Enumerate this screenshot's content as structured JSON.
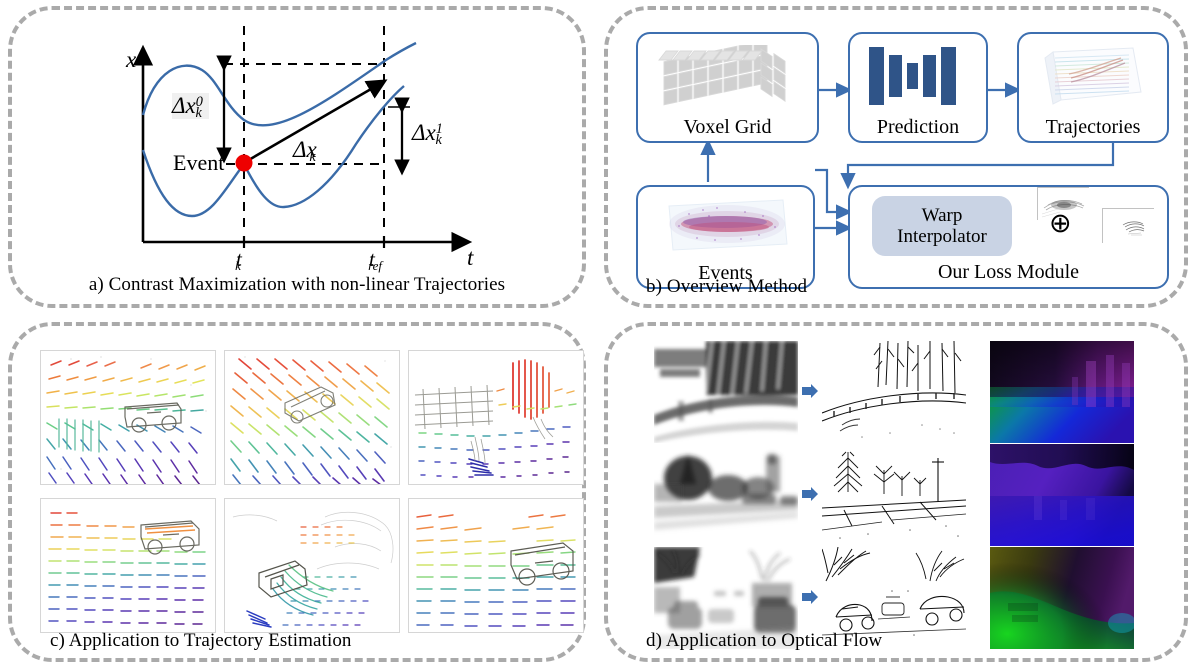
{
  "figure": {
    "panels": [
      {
        "id": "a",
        "caption": "a) Contrast Maximization with non-linear Trajectories"
      },
      {
        "id": "b",
        "caption": "b) Overview Method"
      },
      {
        "id": "c",
        "caption": "c) Application to Trajectory Estimation"
      },
      {
        "id": "d",
        "caption": "d) Application to Optical Flow"
      }
    ]
  },
  "panel_a": {
    "axis_x_label": "t",
    "axis_y_label": "x",
    "tick_tk": "t",
    "tick_tk_sub": "k",
    "tick_tref": "t",
    "tick_tref_sub": "ref",
    "event_label": "Event",
    "delta_symbol": "Δx",
    "delta_x0_sub": "k",
    "delta_x0_sup": "0",
    "delta_x1_sub": "k",
    "delta_x1_sup": "1",
    "delta_xk_sub": "k",
    "curve_color": "#3a6ba8",
    "event_color": "#ee0000"
  },
  "panel_b": {
    "nodes": [
      {
        "name": "voxel-grid",
        "label": "Voxel Grid",
        "art": "voxel-cube-icon"
      },
      {
        "name": "prediction",
        "label": "Prediction",
        "art": "unet-bars-icon"
      },
      {
        "name": "trajectories",
        "label": "Trajectories",
        "art": "trajectory-volume-icon"
      },
      {
        "name": "events",
        "label": "Events",
        "art": "event-cloud-icon"
      },
      {
        "name": "loss-module",
        "label": "Our Loss Module",
        "art": ""
      }
    ],
    "warp_line1": "Warp",
    "warp_line2": "Interpolator",
    "operator": "⊕",
    "box_border_color": "#3d6fb0",
    "warp_fill_color": "#c9d3e4",
    "network_bar_color": "#2f5488"
  },
  "panel_c": {
    "tiles": [
      {
        "name": "trajectory-tile-1",
        "alt": "rainbow trajectory field over car"
      },
      {
        "name": "trajectory-tile-2",
        "alt": "diagonal rainbow trajectory field"
      },
      {
        "name": "trajectory-tile-3",
        "alt": "trajectory field with vertical red streaks"
      },
      {
        "name": "trajectory-tile-4",
        "alt": "horizontal rainbow trajectory field"
      },
      {
        "name": "trajectory-tile-5",
        "alt": "sparse curved trajectory field"
      },
      {
        "name": "trajectory-tile-6",
        "alt": "rainbow trajectory field over vehicle"
      }
    ]
  },
  "panel_d": {
    "rows": [
      {
        "name": "flow-row-1",
        "blurred": "blurry road with guardrail and trees",
        "sharp": "sharpened road with guardrail and trees",
        "flow": "optical flow map, purple and green"
      },
      {
        "name": "flow-row-2",
        "blurred": "blurry street with trees and tower",
        "sharp": "sharpened street with trees and pole",
        "flow": "optical flow map, purple and blue"
      },
      {
        "name": "flow-row-3",
        "blurred": "blurry street with parked cars",
        "sharp": "sharpened street with parked cars",
        "flow": "optical flow map, green and dark"
      }
    ],
    "arrow_color": "#3d6fb0"
  },
  "chart_data": {
    "type": "line",
    "title": "Contrast Maximization with non-linear Trajectories",
    "xlabel": "t",
    "ylabel": "x",
    "xticks": [
      "t_k",
      "t_ref"
    ],
    "xtick_positions": [
      0.37,
      0.78
    ],
    "grid": false,
    "legend": null,
    "annotations": [
      {
        "text": "Event",
        "x": 0.37,
        "y": 0.47,
        "marker": "red-dot"
      },
      {
        "text": "Δx_k^0",
        "type": "vertical-double-arrow",
        "at_x": 0.335,
        "from_y": 0.72,
        "to_y": 0.9
      },
      {
        "text": "Δx_k^1",
        "type": "vertical-double-arrow",
        "at_x": 0.815,
        "from_y": 0.33,
        "to_y": 0.58
      },
      {
        "text": "Δx_k",
        "type": "arrow",
        "from": [
          0.37,
          0.47
        ],
        "to": [
          0.78,
          0.73
        ]
      }
    ],
    "series": [
      {
        "name": "upper trajectory",
        "x": [
          0.1,
          0.17,
          0.24,
          0.3,
          0.37,
          0.46,
          0.57,
          0.68,
          0.78,
          0.84
        ],
        "y": [
          0.52,
          0.74,
          0.82,
          0.77,
          0.66,
          0.68,
          0.74,
          0.82,
          0.9,
          0.95
        ]
      },
      {
        "name": "lower trajectory",
        "x": [
          0.1,
          0.17,
          0.24,
          0.3,
          0.37,
          0.45,
          0.52,
          0.62,
          0.72,
          0.78,
          0.84
        ],
        "y": [
          0.36,
          0.24,
          0.15,
          0.2,
          0.33,
          0.28,
          0.17,
          0.24,
          0.42,
          0.58,
          0.68
        ]
      }
    ]
  }
}
